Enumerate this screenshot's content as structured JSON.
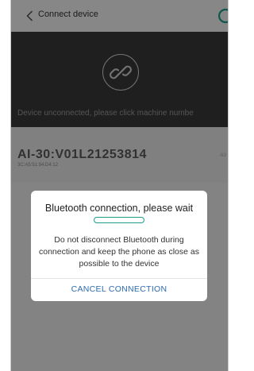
{
  "header": {
    "title": "Connect device",
    "back_icon": "chevron-left-icon",
    "refresh_icon": "refresh-icon"
  },
  "banner": {
    "icon": "link-icon",
    "message": "Device unconnected, please click machine numbe"
  },
  "device": {
    "name": "AI-30:V01L21253814",
    "mac": "3C:A5:51:94:D4:12",
    "signal": "-63"
  },
  "dialog": {
    "title": "Bluetooth connection, please wait",
    "message": "Do not disconnect Bluetooth during connection and keep the phone as close as possible to the device",
    "cancel_label": "CANCEL CONNECTION"
  },
  "colors": {
    "accent": "#1e9e8a",
    "link": "#2b6cb0",
    "banner_bg": "#3a3a3a"
  }
}
